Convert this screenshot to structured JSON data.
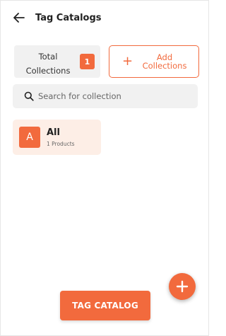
{
  "header": {
    "back_icon": "arrow-left-icon",
    "title": "Tag Catalogs"
  },
  "stats": {
    "label_line1": "Total",
    "label_line2": "Collections",
    "count": "1"
  },
  "add_collections": {
    "icon": "plus-icon",
    "label_line1": "Add",
    "label_line2": "Collections"
  },
  "search": {
    "icon": "search-icon",
    "placeholder": "Search for collection",
    "value": ""
  },
  "collections": [
    {
      "avatar": "A",
      "name": "All",
      "count": "1 Products"
    }
  ],
  "fab": {
    "icon": "plus-icon"
  },
  "primary_button": {
    "label": "TAG CATALOG"
  },
  "colors": {
    "accent": "#f26a3d",
    "card_tint": "#fdeee6",
    "surface": "#f1f1f1"
  }
}
